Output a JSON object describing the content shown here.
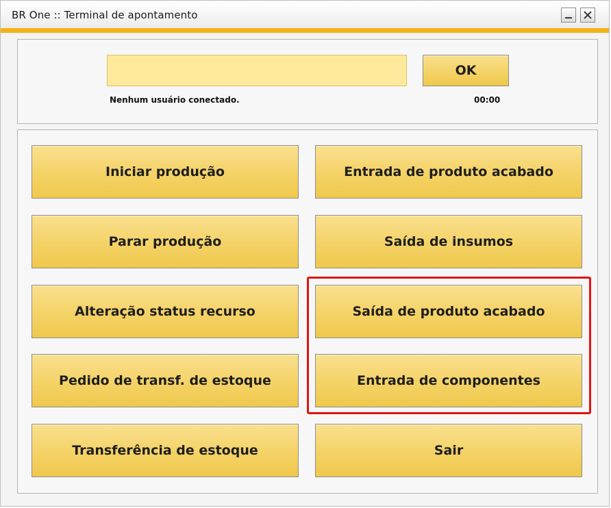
{
  "window": {
    "title": "BR One :: Terminal de apontamento",
    "accent_color": "#f3b316"
  },
  "login": {
    "input_value": "",
    "ok_label": "OK",
    "status_text": "Nenhum usuário conectado.",
    "clock": "00:00"
  },
  "actions": {
    "iniciar_producao": "Iniciar produção",
    "entrada_produto_acabado": "Entrada de produto acabado",
    "parar_producao": "Parar produção",
    "saida_insumos": "Saída de insumos",
    "alteracao_status_recurso": "Alteração status recurso",
    "saida_produto_acabado": "Saída de produto acabado",
    "pedido_transf_estoque": "Pedido de transf. de estoque",
    "entrada_componentes": "Entrada de componentes",
    "transferencia_estoque": "Transferência de estoque",
    "sair": "Sair"
  },
  "highlight_color": "#e11212"
}
